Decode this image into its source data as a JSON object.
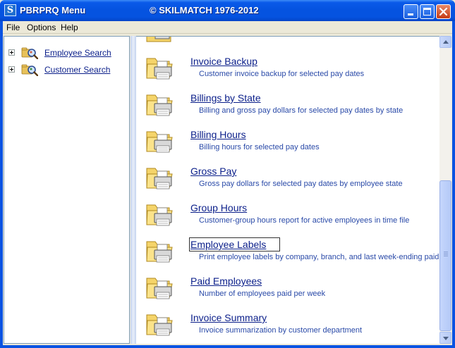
{
  "window": {
    "title": "PBRPRQ Menu",
    "copyright": "© SKILMATCH 1976-2012",
    "app_icon_letter": "S"
  },
  "menu": [
    "File",
    "Options",
    "Help"
  ],
  "tree": {
    "items": [
      {
        "label": "Employee Search",
        "icon": "employee-search-icon"
      },
      {
        "label": "Customer Search",
        "icon": "customer-search-icon"
      }
    ]
  },
  "reports": [
    {
      "title": "Invoice Backup",
      "desc": "Customer invoice backup for selected pay dates"
    },
    {
      "title": "Billings by State",
      "desc": "Billing and gross pay dollars for selected pay dates by state"
    },
    {
      "title": "Billing Hours",
      "desc": "Billing hours for selected pay dates"
    },
    {
      "title": "Gross Pay",
      "desc": "Gross pay dollars for selected pay dates by employee state"
    },
    {
      "title": "Group Hours",
      "desc": "Customer-group hours report for active employees in time file"
    },
    {
      "title": "Employee Labels",
      "desc": "Print employee labels by company, branch, and last week-ending paid"
    },
    {
      "title": "Paid Employees",
      "desc": "Number of employees paid per week"
    },
    {
      "title": "Invoice Summary",
      "desc": "Invoice summarization by customer department"
    }
  ],
  "colors": {
    "link": "#0b1f8a",
    "description": "#2a4aa8",
    "titlebar": "#0553e0"
  }
}
